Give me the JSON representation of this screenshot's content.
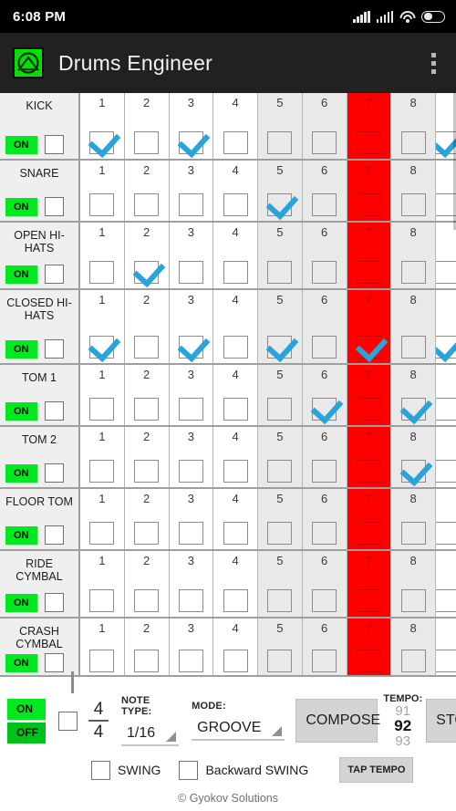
{
  "status_bar": {
    "time": "6:08 PM",
    "icons": [
      "signal-icon",
      "signal-icon",
      "wifi-icon",
      "battery-icon"
    ]
  },
  "action_bar": {
    "logo": "app-logo-icon",
    "title": "Drums Engineer",
    "overflow": "overflow-menu-icon"
  },
  "sequencer": {
    "on_label": "ON",
    "step_numbers": [
      "1",
      "2",
      "3",
      "4",
      "5",
      "6",
      "7",
      "8"
    ],
    "accent_step": "7",
    "accent_color": "#FF0000",
    "shaded_steps": [
      "5",
      "6",
      "8"
    ],
    "on_color": "#00E81E",
    "check_color": "#29A3DB",
    "rows": [
      {
        "name": "KICK",
        "on": "ON",
        "mute": false,
        "steps": [
          true,
          false,
          true,
          false,
          false,
          false,
          false,
          false
        ],
        "partial_checked": true
      },
      {
        "name": "SNARE",
        "on": "ON",
        "mute": false,
        "steps": [
          false,
          false,
          false,
          false,
          true,
          false,
          false,
          false
        ],
        "partial_checked": false
      },
      {
        "name": "OPEN HI-HATS",
        "on": "ON",
        "mute": false,
        "steps": [
          false,
          true,
          false,
          false,
          false,
          false,
          false,
          false
        ],
        "partial_checked": false
      },
      {
        "name": "CLOSED HI-HATS",
        "on": "ON",
        "mute": false,
        "steps": [
          true,
          false,
          true,
          false,
          true,
          false,
          true,
          false
        ],
        "partial_checked": true
      },
      {
        "name": "TOM 1",
        "on": "ON",
        "mute": false,
        "steps": [
          false,
          false,
          false,
          false,
          false,
          true,
          false,
          true
        ],
        "partial_checked": false
      },
      {
        "name": "TOM 2",
        "on": "ON",
        "mute": false,
        "steps": [
          false,
          false,
          false,
          false,
          false,
          false,
          false,
          true
        ],
        "partial_checked": false
      },
      {
        "name": "FLOOR TOM",
        "on": "ON",
        "mute": false,
        "steps": [
          false,
          false,
          false,
          false,
          false,
          false,
          false,
          false
        ],
        "partial_checked": false
      },
      {
        "name": "RIDE CYMBAL",
        "on": "ON",
        "mute": false,
        "steps": [
          false,
          false,
          false,
          false,
          false,
          false,
          false,
          false
        ],
        "partial_checked": false
      },
      {
        "name": "CRASH CYMBAL",
        "on": "ON",
        "mute": false,
        "steps": [
          false,
          false,
          false,
          false,
          false,
          false,
          false,
          false
        ],
        "partial_checked": false
      }
    ]
  },
  "controls": {
    "metronome_on": "ON",
    "metronome_off": "OFF",
    "metronome_checkbox_checked": false,
    "time_signature_top": "4",
    "time_signature_bottom": "4",
    "note_type_label": "NOTE TYPE:",
    "note_type_value": "1/16",
    "mode_label": "MODE:",
    "mode_value": "GROOVE",
    "compose_label": "COMPOSE",
    "stop_label": "STOP",
    "tempo_label": "TEMPO:",
    "tempo_prev": "91",
    "tempo_current": "92",
    "tempo_next": "93",
    "swing_label": "SWING",
    "swing_checked": false,
    "backward_swing_label": "Backward SWING",
    "backward_swing_checked": false,
    "tap_tempo_label": "TAP TEMPO"
  },
  "footer": {
    "copyright": "© Gyokov Solutions"
  }
}
